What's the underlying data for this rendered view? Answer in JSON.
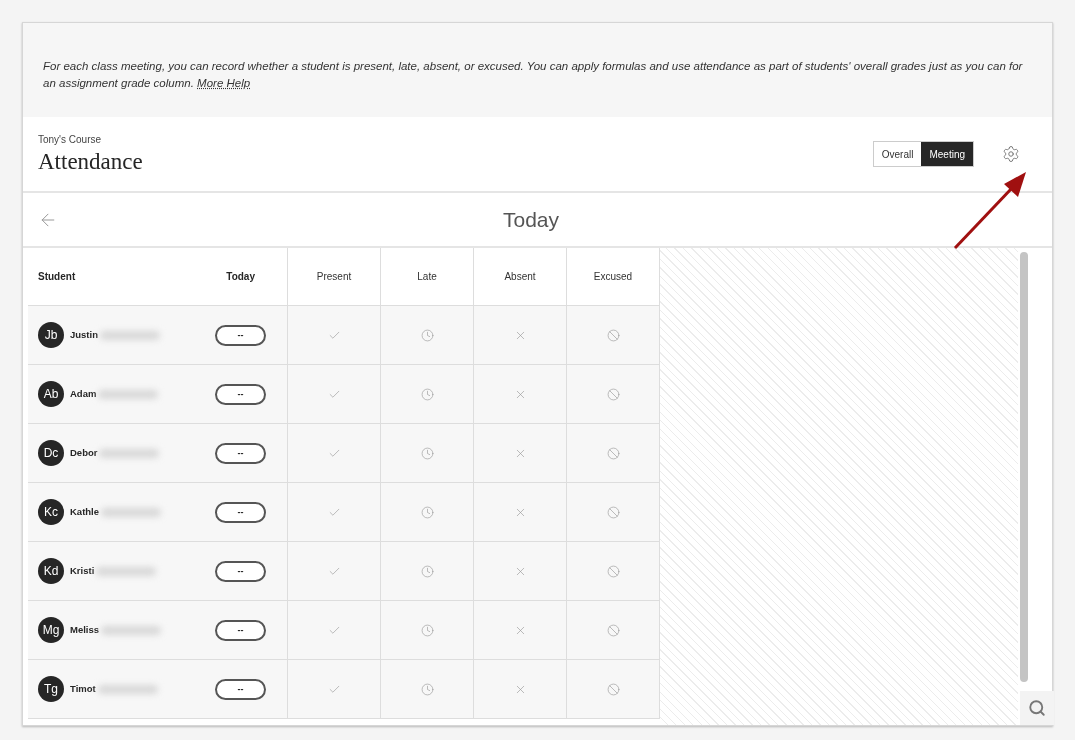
{
  "banner": {
    "text": "*For each class meeting, you can record whether a student is present, late, absent, or excused. You can apply formulas and use attendance as part of students' overall grades just as you can for an assignment grade column.*",
    "link": "More Help"
  },
  "header": {
    "course": "Tony's Course",
    "title": "Attendance"
  },
  "views": [
    {
      "label": "Overall",
      "selected": false
    },
    {
      "label": "Meeting",
      "selected": true
    }
  ],
  "date_bar": {
    "title": "Today"
  },
  "table": {
    "columns": [
      "Student",
      "Today",
      "Present",
      "Late",
      "Absent",
      "Excused"
    ],
    "rows": [
      {
        "initials": "Jb",
        "name": "Justin",
        "status": "--"
      },
      {
        "initials": "Ab",
        "name": "Adam",
        "status": "--"
      },
      {
        "initials": "Dc",
        "name": "Debor",
        "status": "--"
      },
      {
        "initials": "Kc",
        "name": "Kathle",
        "status": "--"
      },
      {
        "initials": "Kd",
        "name": "Kristi",
        "status": "--"
      },
      {
        "initials": "Mg",
        "name": "Meliss",
        "status": "--"
      },
      {
        "initials": "Tg",
        "name": "Timot",
        "status": "--"
      }
    ]
  }
}
